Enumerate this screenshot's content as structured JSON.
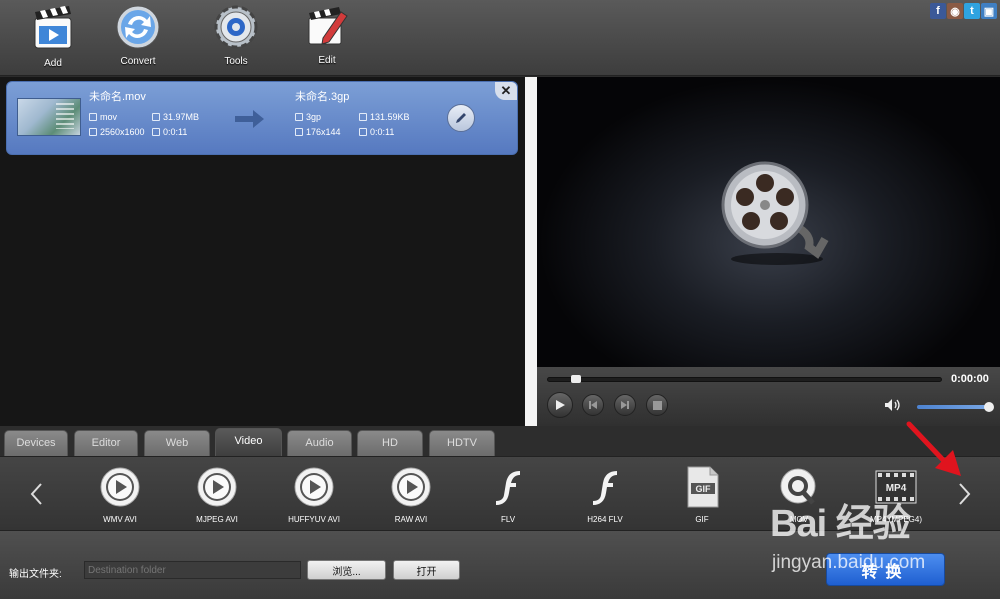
{
  "toolbar": {
    "add_label": "Add",
    "convert_label": "Convert",
    "tools_label": "Tools",
    "edit_label": "Edit"
  },
  "social": [
    "f",
    "ig",
    "t",
    "o"
  ],
  "file_item": {
    "source_name": "未命名.mov",
    "source_format": "mov",
    "source_size": "31.97MB",
    "source_resolution": "2560x1600",
    "source_duration": "0:0:11",
    "target_name": "未命名.3gp",
    "target_format": "3gp",
    "target_size": "131.59KB",
    "target_resolution": "176x144",
    "target_duration": "0:0:11"
  },
  "player": {
    "time": "0:00:00",
    "seek_progress": 0.06,
    "volume": 0.95
  },
  "tabs": [
    {
      "label": "Devices",
      "active": false
    },
    {
      "label": "Editor",
      "active": false
    },
    {
      "label": "Web",
      "active": false
    },
    {
      "label": "Video",
      "active": true
    },
    {
      "label": "Audio",
      "active": false
    },
    {
      "label": "HD",
      "active": false
    },
    {
      "label": "HDTV",
      "active": false
    }
  ],
  "formats": [
    {
      "label": "WMV AVI",
      "icon": "play-circle-icon"
    },
    {
      "label": "MJPEG AVI",
      "icon": "play-circle-icon"
    },
    {
      "label": "HUFFYUV AVI",
      "icon": "play-circle-icon"
    },
    {
      "label": "RAW AVI",
      "icon": "play-circle-icon"
    },
    {
      "label": "FLV",
      "icon": "flash-icon"
    },
    {
      "label": "H264 FLV",
      "icon": "flash-icon"
    },
    {
      "label": "GIF",
      "icon": "gif-file-icon"
    },
    {
      "label": "MOV",
      "icon": "quicktime-icon"
    },
    {
      "label": "MP4 (MPEG4)",
      "icon": "mp4-film-icon"
    }
  ],
  "bottom": {
    "output_label": "输出文件夹:",
    "destination_placeholder": "Destination folder",
    "browse_label": "浏览...",
    "open_label": "打开",
    "convert_label": "转换"
  },
  "watermark": {
    "brand": "Bai 经验",
    "url": "jingyan.baidu.com"
  },
  "colors": {
    "accent_blue": "#5679c0",
    "convert_button": "#2f6fe0",
    "annotation_arrow": "#e0141e"
  }
}
